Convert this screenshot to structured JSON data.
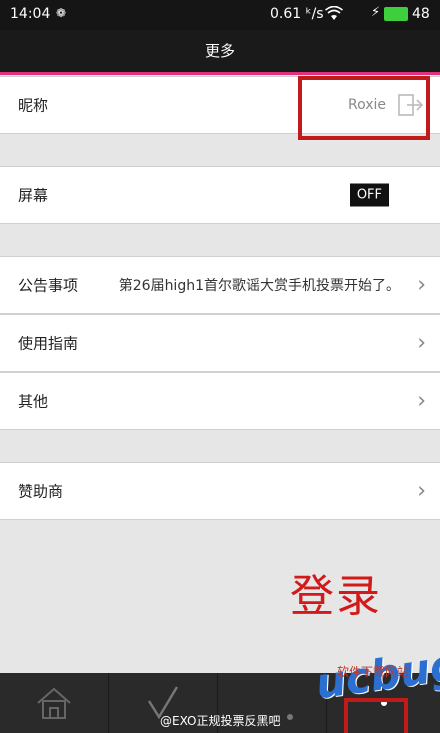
{
  "status": {
    "time": "14:04",
    "net_speed": "0.61 ᵏ/s",
    "battery": "48"
  },
  "header": {
    "title": "更多"
  },
  "rows": {
    "nickname": {
      "label": "昵称",
      "value": "Roxie"
    },
    "screen": {
      "label": "屏幕",
      "value": "OFF"
    },
    "notice": {
      "label": "公告事项",
      "value": "第26届high1首尔歌谣大赏手机投票开始了。"
    },
    "guide": {
      "label": "使用指南"
    },
    "other": {
      "label": "其他"
    },
    "sponsor": {
      "label": "赞助商"
    }
  },
  "annotation": {
    "login_label": "登录"
  },
  "footer": {
    "watermark": "@EXO正规投票反黑吧",
    "site_logo": "ucbug.cc",
    "site_sub": "软件下载网站"
  },
  "colors": {
    "accent": "#e0327c",
    "annotation_red": "#d21a1a"
  }
}
